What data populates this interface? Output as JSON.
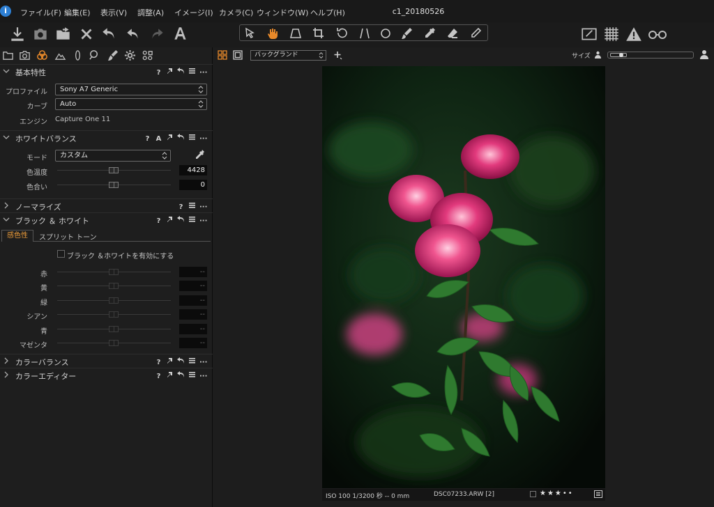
{
  "menubar": {
    "items": [
      "ファイル(F)",
      "編集(E)",
      "表示(V)",
      "調整(A)",
      "イメージ(I)",
      "カメラ(C)",
      "ウィンドウ(W)",
      "ヘルプ(H)"
    ],
    "title": "c1_20180526"
  },
  "toolbar": {
    "left_icons": [
      "import-icon",
      "camera-icon",
      "export-folder-icon",
      "delete-icon",
      "undo-icon",
      "undo-step-icon",
      "redo-icon",
      "text-icon"
    ],
    "cursor_tools": [
      "select-icon",
      "pan-icon",
      "keystone-icon",
      "crop-icon",
      "rotate-icon",
      "straighten-icon",
      "circle-icon",
      "brush-icon",
      "picker-icon",
      "eraser-icon",
      "pen-icon"
    ],
    "right_icons": [
      "edit-icon",
      "grid-icon",
      "warning-icon",
      "glasses-icon"
    ],
    "active_tool_color": "#e8892a"
  },
  "left_panel": {
    "tabs": [
      "folder-icon",
      "camera-tab-icon",
      "color-icon",
      "exposure-icon",
      "lens-icon",
      "search-icon",
      "brush-tab-icon",
      "settings-icon",
      "metadata-icon"
    ],
    "basic": {
      "title": "基本特性",
      "profile_label": "プロファイル",
      "profile_value": "Sony A7 Generic",
      "curve_label": "カーブ",
      "curve_value": "Auto",
      "engine_label": "エンジン",
      "engine_value": "Capture One 11"
    },
    "white_balance": {
      "title": "ホワイトバランス",
      "mode_label": "モード",
      "mode_value": "カスタム",
      "temp_label": "色温度",
      "temp_value": "4428",
      "tint_label": "色合い",
      "tint_value": "0",
      "auto_badge": "A",
      "help_badge": "?"
    },
    "normalize": {
      "title": "ノーマライズ"
    },
    "bw": {
      "title": "ブラック ＆ ホワイト",
      "tab_sensitivity": "感色性",
      "tab_split": "スプリット トーン",
      "enable_label": "ブラック ＆ホワイトを有効にする",
      "channels": [
        {
          "label": "赤",
          "value": "--"
        },
        {
          "label": "黄",
          "value": "--"
        },
        {
          "label": "緑",
          "value": "--"
        },
        {
          "label": "シアン",
          "value": "--"
        },
        {
          "label": "青",
          "value": "--"
        },
        {
          "label": "マゼンタ",
          "value": "--"
        }
      ]
    },
    "color_balance": {
      "title": "カラーバランス"
    },
    "color_editor": {
      "title": "カラーエディター"
    }
  },
  "viewer": {
    "background_select": "バックグランド",
    "size_label": "サイズ",
    "photo_meta": "ISO 100  1/3200 秒  --  0 mm",
    "photo_filename": "DSC07233.ARW [2]",
    "rating": 3,
    "rating_max": 5
  }
}
